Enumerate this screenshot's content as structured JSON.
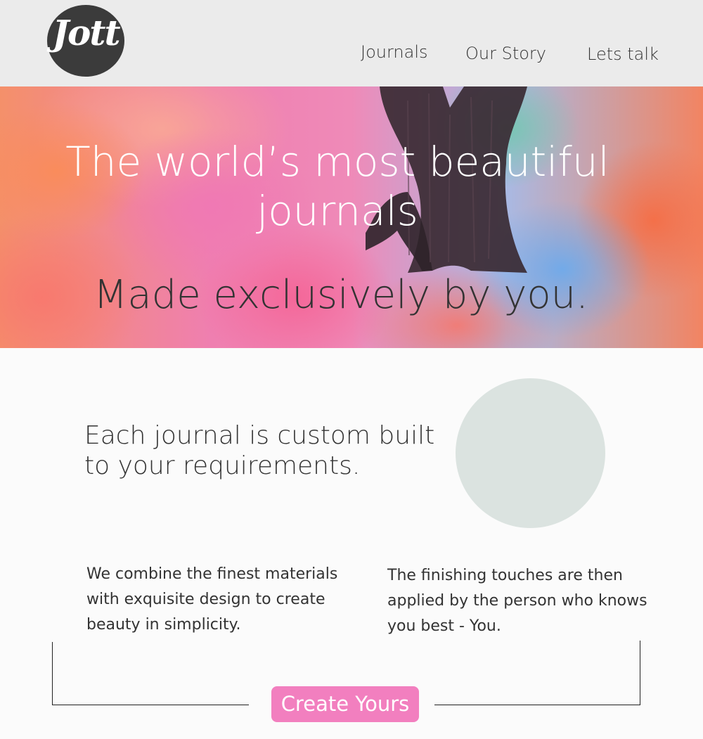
{
  "header": {
    "logo_text": "Jott",
    "nav": [
      "Journals",
      "Our Story",
      "Lets talk"
    ]
  },
  "hero": {
    "title": "The world’s most beautiful journals",
    "subtitle": "Made exclusively by you."
  },
  "intro": {
    "heading": "Each journal is custom built to your requirements."
  },
  "features": {
    "left": "We combine the finest materials with exquisite design to create beauty in simplicity.",
    "right": "The finishing touches are then applied by the person who knows you best - You."
  },
  "cta": {
    "label": "Create Yours"
  },
  "colors": {
    "header_bg": "#ebebeb",
    "logo_bg": "#3b3b3b",
    "cta_bg": "#f27fbf",
    "circle": "#dbe3e0"
  }
}
